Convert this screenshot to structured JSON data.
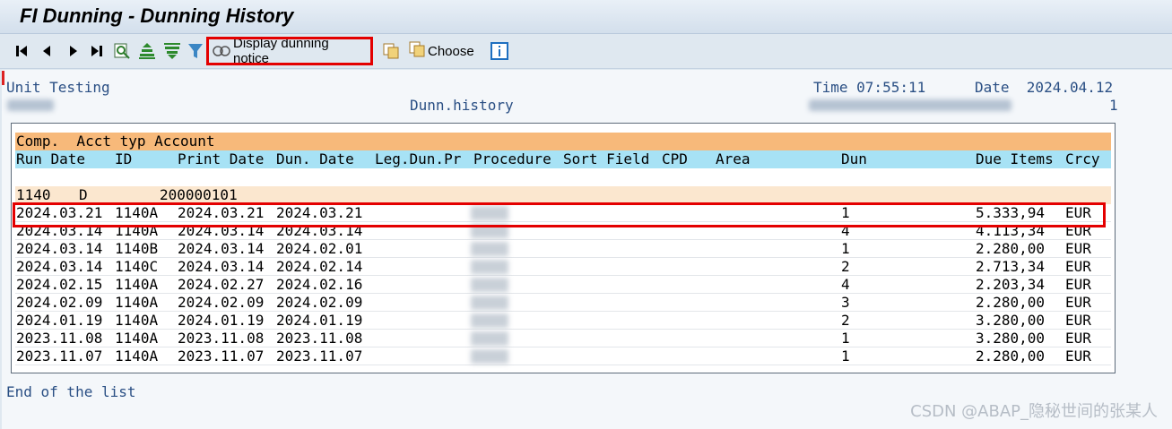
{
  "window": {
    "title": "FI Dunning - Dunning History"
  },
  "toolbar": {
    "display_label": "Display dunning notice",
    "choose_label": "Choose",
    "icons": [
      "first-page-icon",
      "previous-page-icon",
      "next-page-icon",
      "last-page-icon",
      "find-icon",
      "sort-ascending-icon",
      "sort-descending-icon",
      "filter-icon",
      "display-dunning-notice-icon",
      "copy-icon",
      "choose-icon",
      "info-icon"
    ]
  },
  "report": {
    "line1_left": "Unit Testing",
    "line1_time": "Time 07:55:11",
    "line1_date": "Date  2024.04.12",
    "line2_center": "Dunn.history",
    "line2_page": "1"
  },
  "list": {
    "header1": "Comp.  Acct typ Account",
    "columns": [
      "Run Date",
      "ID",
      "Print Date",
      "Dun. Date",
      "Leg.Dun.Pr",
      "Procedure",
      "Sort Field",
      "CPD",
      "Area",
      "Dun",
      "Due Items",
      "Crcy"
    ],
    "group": {
      "comp": "1140",
      "acct_type": "D",
      "account": "200000101"
    },
    "rows": [
      {
        "run_date": "2024.03.21",
        "id": "1140A",
        "print_date": "2024.03.21",
        "dun_date": "2024.03.21",
        "dun": "1",
        "due_items": "5.333,94",
        "crcy": "EUR"
      },
      {
        "run_date": "2024.03.14",
        "id": "1140A",
        "print_date": "2024.03.14",
        "dun_date": "2024.03.14",
        "dun": "4",
        "due_items": "4.113,34",
        "crcy": "EUR"
      },
      {
        "run_date": "2024.03.14",
        "id": "1140B",
        "print_date": "2024.03.14",
        "dun_date": "2024.02.01",
        "dun": "1",
        "due_items": "2.280,00",
        "crcy": "EUR"
      },
      {
        "run_date": "2024.03.14",
        "id": "1140C",
        "print_date": "2024.03.14",
        "dun_date": "2024.02.14",
        "dun": "2",
        "due_items": "2.713,34",
        "crcy": "EUR"
      },
      {
        "run_date": "2024.02.15",
        "id": "1140A",
        "print_date": "2024.02.27",
        "dun_date": "2024.02.16",
        "dun": "4",
        "due_items": "2.203,34",
        "crcy": "EUR"
      },
      {
        "run_date": "2024.02.09",
        "id": "1140A",
        "print_date": "2024.02.09",
        "dun_date": "2024.02.09",
        "dun": "3",
        "due_items": "2.280,00",
        "crcy": "EUR"
      },
      {
        "run_date": "2024.01.19",
        "id": "1140A",
        "print_date": "2024.01.19",
        "dun_date": "2024.01.19",
        "dun": "2",
        "due_items": "3.280,00",
        "crcy": "EUR"
      },
      {
        "run_date": "2023.11.08",
        "id": "1140A",
        "print_date": "2023.11.08",
        "dun_date": "2023.11.08",
        "dun": "1",
        "due_items": "3.280,00",
        "crcy": "EUR"
      },
      {
        "run_date": "2023.11.07",
        "id": "1140A",
        "print_date": "2023.11.07",
        "dun_date": "2023.11.07",
        "dun": "1",
        "due_items": "2.280,00",
        "crcy": "EUR"
      }
    ],
    "end_text": "End of the list"
  },
  "watermark": "CSDN @ABAP_隐秘世间的张某人",
  "colors": {
    "highlight": "#e40000",
    "header_orange": "#f7b97a",
    "header_blue": "#a7e2f5",
    "group_bg": "#fbe7cf"
  }
}
